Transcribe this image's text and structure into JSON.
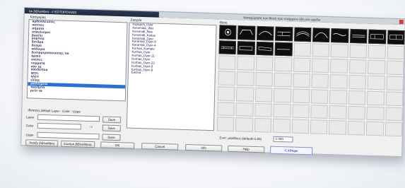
{
  "window": {
    "title_left": "ται βιβλιοθήκη : c:\\SDTOPO\\ASD\\",
    "title_right": "Καταχώρηση των Block που υπάρχουν ήδη στο σχέδιο"
  },
  "left_panel": {
    "header": "Κατηγορίες",
    "items": [
      "αρθοπλευσεις",
      "ακτίτος",
      "σήματα",
      "σταυλισμοί",
      "βασίλε",
      "ρομπερ",
      "δένδρα",
      "δεσμα",
      "κάδοιρα",
      "δεκτρμεροποιούτης τικ",
      "άραιο",
      "σκύτες",
      "νομματά",
      "κάν τα",
      "καοδόποα",
      "φητς",
      "ηλέιτ",
      "ελλης",
      "ραπεζμεια",
      "παγδρτα",
      "ρελτ τα"
    ],
    "selected_index": 18
  },
  "middle_panel": {
    "header": "Στοιχεία",
    "items": [
      "Κεραμιδι_Dyer",
      "Kerarnida_Wei",
      "Kerarnidi_Nee",
      "Kerarnidi_Koilas",
      "Kerarnidi_Dyer",
      "Keramidi_Dyer-9",
      "Keramidi_Dyer-4",
      "Korhas_Kampio",
      "Korhas_Dyer",
      "Korhas_Dyer-11",
      "Korhas_Dyer",
      "Korhas_Dyer-22",
      "Korhas_Dyer-9",
      "Korhas_Dyer-8",
      "Εικόνα"
    ],
    "selected_index": -1
  },
  "preview": {
    "header": "Θέση",
    "dark_count": 14,
    "total_cells": 70
  },
  "layer_settings": {
    "heading": "Ιδιότητες default Layer - Color - Ltype",
    "layer_label": "Layer",
    "color_label": "Color",
    "ltype_label": "Ltype",
    "arrow": "->",
    "save_label": "Save"
  },
  "bottom": {
    "btn_open_lib": "Άνοιξε βιβλιοθήκη",
    "btn_save_lib": "Σώσιμο βιβλιοθήκης",
    "btn_ok": "OK",
    "btn_cancel": "Cancel",
    "btn_info": "Info",
    "btn_help": "Help",
    "logo": "CADtopo",
    "size_label": "Συντ. μεγέθους (default=1.00)",
    "size_value": "1.000"
  },
  "colors": {
    "selection": "#2e6fd0",
    "title_bar": "#1e2a3e",
    "logo": "#3344aa"
  }
}
